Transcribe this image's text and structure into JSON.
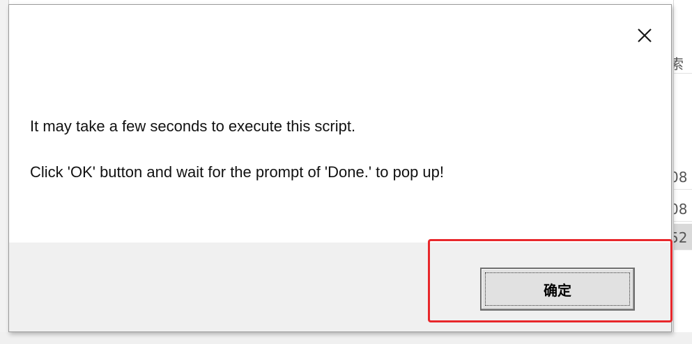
{
  "background": {
    "right_column_rows": [
      {
        "text": "索",
        "selected": false
      },
      {
        "text": "08",
        "selected": false
      },
      {
        "text": "08",
        "selected": false
      },
      {
        "text": "52",
        "selected": true
      }
    ]
  },
  "dialog": {
    "close_icon": "close-icon",
    "message_line1": "It may take a few seconds to execute this script.",
    "message_line2": "Click 'OK' button and wait for the prompt of 'Done.' to pop up!",
    "ok_button_label": "确定"
  },
  "annotation": {
    "highlight_color": "#e8272b"
  }
}
